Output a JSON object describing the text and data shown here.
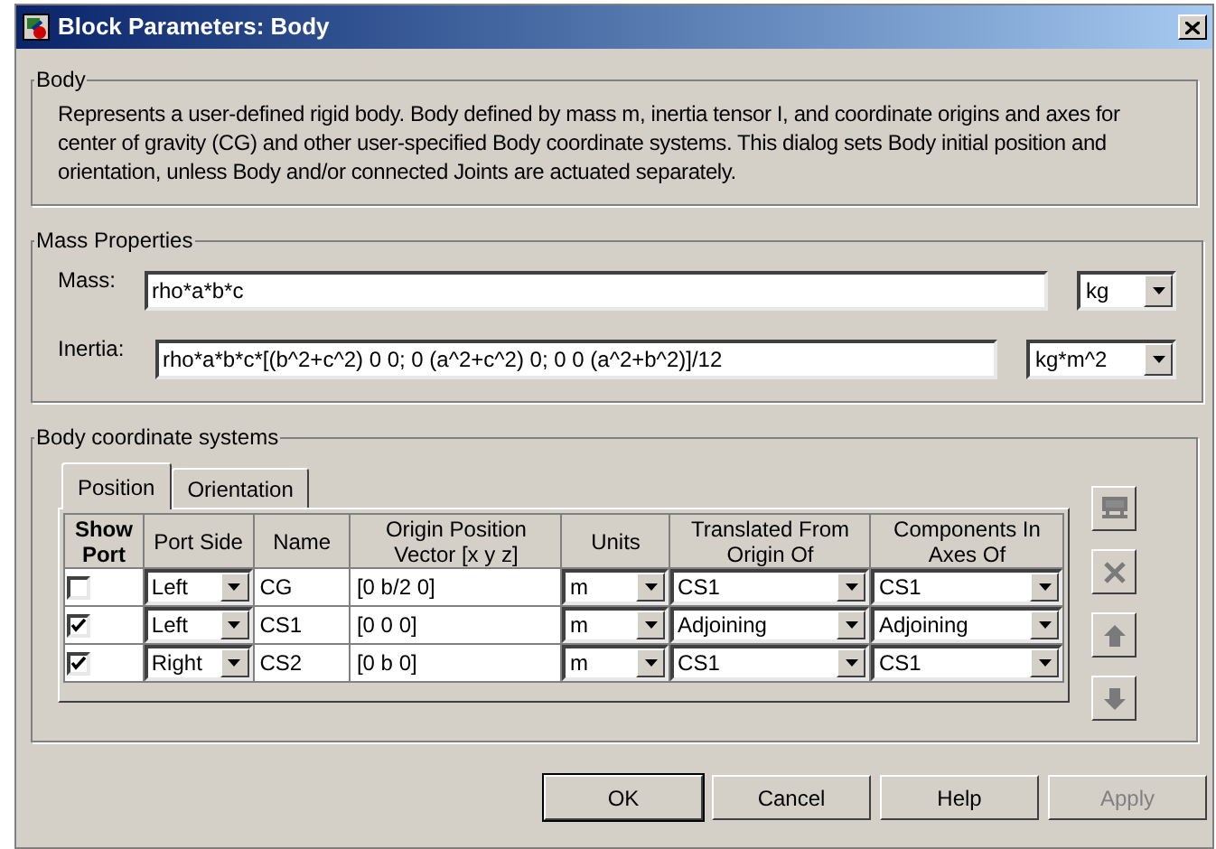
{
  "window": {
    "title": "Block Parameters: Body"
  },
  "body_group": {
    "title": "Body",
    "description": "Represents a user-defined rigid body. Body defined by mass m, inertia tensor I, and coordinate origins and axes for center of gravity (CG) and other user-specified Body coordinate systems. This dialog sets Body initial position and orientation, unless Body and/or connected Joints are actuated separately."
  },
  "mass_properties": {
    "title": "Mass Properties",
    "fields": [
      {
        "label": "Mass:",
        "value": "rho*a*b*c",
        "unit": "kg"
      },
      {
        "label": "Inertia:",
        "value": "rho*a*b*c*[(b^2+c^2) 0 0; 0 (a^2+c^2) 0; 0 0 (a^2+b^2)]/12",
        "unit": "kg*m^2"
      }
    ]
  },
  "coordinate_systems": {
    "title": "Body coordinate systems",
    "tabs": [
      {
        "label": "Position",
        "selected": true
      },
      {
        "label": "Orientation",
        "selected": false
      }
    ],
    "table": {
      "columns": [
        "Show Port",
        "Port Side",
        "Name",
        "Origin Position Vector [x y z]",
        "Units",
        "Translated From Origin Of",
        "Components In Axes Of"
      ],
      "rows": [
        {
          "show_port": false,
          "port_side": "Left",
          "name": "CG",
          "origin": "[0 b/2 0]",
          "units": "m",
          "translated_from": "CS1",
          "components_in": "CS1"
        },
        {
          "show_port": true,
          "port_side": "Left",
          "name": "CS1",
          "origin": "[0 0 0]",
          "units": "m",
          "translated_from": "Adjoining",
          "components_in": "Adjoining"
        },
        {
          "show_port": true,
          "port_side": "Right",
          "name": "CS2",
          "origin": "[0 b 0]",
          "units": "m",
          "translated_from": "CS1",
          "components_in": "CS1"
        }
      ]
    }
  },
  "buttons": [
    {
      "label": "OK",
      "disabled": false
    },
    {
      "label": "Cancel",
      "disabled": false
    },
    {
      "label": "Help",
      "disabled": false
    },
    {
      "label": "Apply",
      "disabled": true
    }
  ]
}
